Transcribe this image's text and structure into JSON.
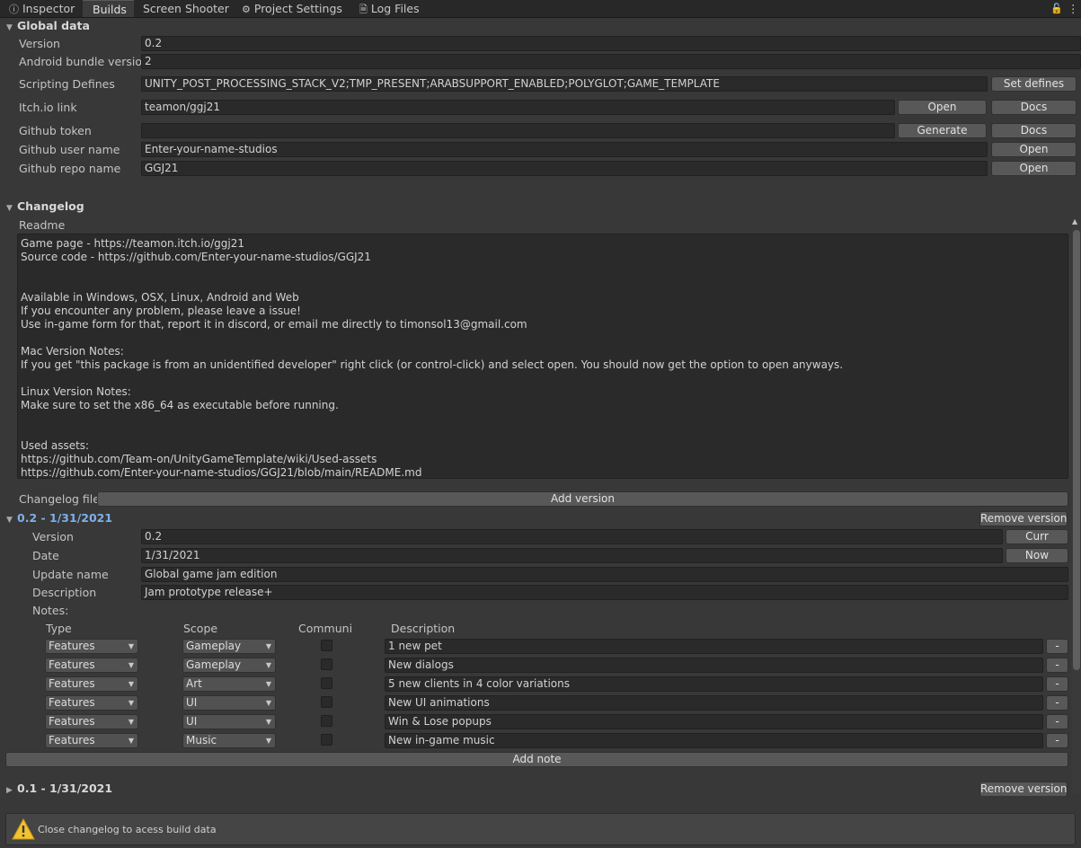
{
  "tabs": [
    {
      "label": "Inspector",
      "icon": "info-icon"
    },
    {
      "label": "Builds",
      "icon": ""
    },
    {
      "label": "Screen Shooter",
      "icon": ""
    },
    {
      "label": "Project Settings",
      "icon": "gear-icon"
    },
    {
      "label": "Log Files",
      "icon": "document-icon"
    }
  ],
  "global": {
    "heading": "Global data",
    "version_label": "Version",
    "version": "0.2",
    "bundle_label": "Android bundle version",
    "bundle": "2",
    "defines_label": "Scripting Defines",
    "defines": "UNITY_POST_PROCESSING_STACK_V2;TMP_PRESENT;ARABSUPPORT_ENABLED;POLYGLOT;GAME_TEMPLATE",
    "set_defines": "Set defines",
    "itch_label": "Itch.io link",
    "itch": "teamon/ggj21",
    "open": "Open",
    "docs": "Docs",
    "token_label": "Github token",
    "token": "",
    "generate": "Generate",
    "user_label": "Github user name",
    "user": "Enter-your-name-studios",
    "repo_label": "Github repo name",
    "repo": "GGJ21"
  },
  "changelog": {
    "heading": "Changelog",
    "readme_label": "Readme",
    "readme_lines": [
      "Game page - https://teamon.itch.io/ggj21",
      "Source code - https://github.com/Enter-your-name-studios/GGJ21",
      "",
      "",
      "Available in Windows, OSX, Linux, Android and Web",
      "If you encounter any problem, please leave a issue!",
      "Use in-game form for that, report it in discord, or email me directly to timonsol13@gmail.com",
      "",
      "Mac Version Notes:",
      "If you get \"this package is from an unidentified developer\" right click (or control-click) and select open. You should now get the option to open anyways.",
      "",
      "Linux Version Notes:",
      "Make sure to set the x86_64 as executable before running.",
      "",
      "",
      "Used assets:",
      "https://github.com/Team-on/UnityGameTemplate/wiki/Used-assets",
      "https://github.com/Enter-your-name-studios/GGJ21/blob/main/README.md"
    ],
    "file_label": "Changelog file:",
    "add_version": "Add version",
    "remove_version": "Remove version",
    "add_note": "Add note"
  },
  "entry": {
    "heading": "0.2 - 1/31/2021",
    "version_label": "Version",
    "version": "0.2",
    "curr": "Curr",
    "date_label": "Date",
    "date": "1/31/2021",
    "now": "Now",
    "update_label": "Update name",
    "update": "Global game jam edition",
    "desc_label": "Description",
    "desc": "Jam prototype release+",
    "notes_label": "Notes:",
    "col_type": "Type",
    "col_scope": "Scope",
    "col_comm": "Communi",
    "col_desc": "Description",
    "notes": [
      {
        "type": "Features",
        "scope": "Gameplay",
        "desc": "1 new pet"
      },
      {
        "type": "Features",
        "scope": "Gameplay",
        "desc": "New dialogs"
      },
      {
        "type": "Features",
        "scope": "Art",
        "desc": "5 new clients in 4 color variations"
      },
      {
        "type": "Features",
        "scope": "UI",
        "desc": "New UI animations"
      },
      {
        "type": "Features",
        "scope": "UI",
        "desc": "Win & Lose popups"
      },
      {
        "type": "Features",
        "scope": "Music",
        "desc": "New in-game music"
      }
    ],
    "minus": "-"
  },
  "entry2": {
    "heading": "0.1 - 1/31/2021"
  },
  "help": {
    "text": "Close changelog to acess build data"
  },
  "colors": {
    "accent": "#7fb0e8",
    "background": "#383838",
    "field": "#2a2a2a",
    "button": "#585858",
    "warning": "#f2c230"
  }
}
